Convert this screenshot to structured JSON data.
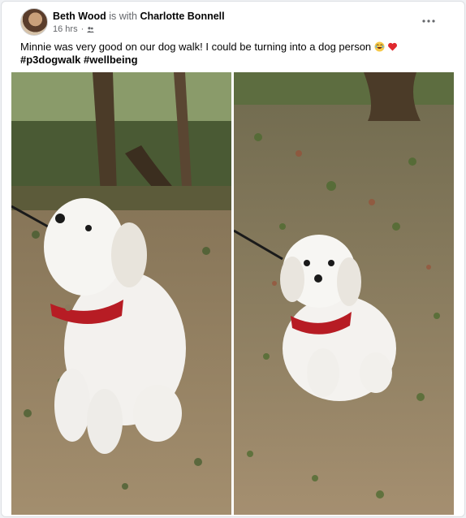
{
  "post": {
    "author": "Beth Wood",
    "with_text": "is with",
    "tagged": "Charlotte Bonnell",
    "time": "16 hrs",
    "privacy_icon": "friends-icon",
    "body_text": "Minnie was very good on our dog walk! I could be turning into a dog person",
    "emojis": [
      "laughing-emoji",
      "red-heart-emoji"
    ],
    "hashtags": [
      "#p3dogwalk",
      "#wellbeing"
    ],
    "more_icon": "more-options-icon"
  },
  "photos": [
    {
      "name": "dog-photo-left",
      "description_icon": "photo"
    },
    {
      "name": "dog-photo-right",
      "description_icon": "photo"
    }
  ],
  "colors": {
    "card_bg": "#ffffff",
    "page_bg": "#f0f2f5",
    "text": "#050505",
    "muted": "#65676b"
  }
}
